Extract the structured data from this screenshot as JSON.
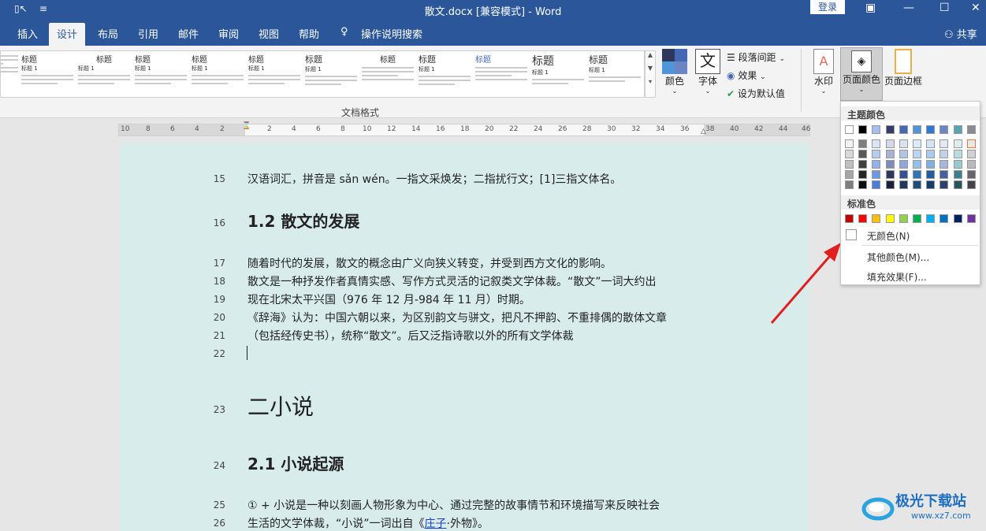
{
  "titlebar": {
    "title": "散文.docx [兼容模式]  -  Word",
    "login": "登录"
  },
  "tabs": [
    "插入",
    "设计",
    "布局",
    "引用",
    "邮件",
    "审阅",
    "视图",
    "帮助",
    "操作说明搜索"
  ],
  "share": "共享",
  "ribbon": {
    "gallery_title": "标题",
    "gallery_heading1": "标题 1",
    "group_label": "文档格式",
    "colors_label": "颜色",
    "fonts_label": "字体",
    "fonts_glyph": "文",
    "paragraph_spacing": "段落间距",
    "effects": "效果",
    "set_default": "设为默认值",
    "watermark": "水印",
    "page_color": "页面颜色",
    "page_borders": "页面边框"
  },
  "ruler": {
    "left_numbers": [
      "10",
      "8",
      "6",
      "4",
      "2"
    ],
    "right_numbers": [
      "2",
      "4",
      "6",
      "8",
      "10",
      "12",
      "14",
      "16",
      "18",
      "20",
      "22",
      "24",
      "26",
      "28",
      "30",
      "32",
      "34",
      "36",
      "38",
      "40",
      "42",
      "44",
      "46"
    ]
  },
  "document": {
    "lines": [
      {
        "no": "15",
        "text": "汉语词汇，拼音是 sǎn wén。一指文采焕发；二指扰行文；[1]三指文体名。",
        "style": "body"
      },
      {
        "no": "16",
        "text": "1.2 散文的发展",
        "style": "h2"
      },
      {
        "no": "17",
        "text": "随着时代的发展，散文的概念由广义向狭义转变，并受到西方文化的影响。",
        "style": "body"
      },
      {
        "no": "18",
        "text": "散文是一种抒发作者真情实感、写作方式灵活的记叙类文学体裁。“散文”一词大约出",
        "style": "body"
      },
      {
        "no": "19",
        "text": "现在北宋太平兴国（976 年 12 月-984 年 11 月）时期。",
        "style": "body"
      },
      {
        "no": "20",
        "text": "《辞海》认为：中国六朝以来，为区别韵文与骈文，把凡不押韵、不重排偶的散体文章",
        "style": "body"
      },
      {
        "no": "21",
        "text": "（包括经传史书），统称“散文”。后又泛指诗歌以外的所有文学体裁",
        "style": "body"
      },
      {
        "no": "22",
        "text": "",
        "style": "body"
      },
      {
        "no": "23",
        "text": "二小说",
        "style": "h1"
      },
      {
        "no": "24",
        "text": "2.1 小说起源",
        "style": "h2"
      },
      {
        "no": "25",
        "text": "① + 小说是一种以刻画人物形象为中心、通过完整的故事情节和环境描写来反映社会",
        "style": "body"
      },
      {
        "no": "26",
        "text_before": "生活的文学体裁，“小说”一词出自《",
        "link": "庄子",
        "text_after": "·外物》。",
        "style": "body"
      }
    ]
  },
  "dropdown": {
    "theme_colors_label": "主题颜色",
    "standard_colors_label": "标准色",
    "no_color": "无颜色(N)",
    "more_colors": "其他颜色(M)...",
    "fill_effects": "填充效果(F)...",
    "theme_top": [
      "#ffffff",
      "#000000",
      "#a5c0ef",
      "#333e66",
      "#4568b5",
      "#4f95d8",
      "#2e7ad2",
      "#6c86c5",
      "#58a5b0",
      "#8b8a93"
    ],
    "theme_shades": [
      [
        "#f2f2f2",
        "#d8d8d8",
        "#bfbfbf",
        "#a5a5a5",
        "#7f7f7f"
      ],
      [
        "#7f7f7f",
        "#595959",
        "#3f3f3f",
        "#262626",
        "#0c0c0c"
      ],
      [
        "#dbe5f8",
        "#b7cbf1",
        "#93b2ea",
        "#6e98e3",
        "#4c7ed9"
      ],
      [
        "#d4d8e8",
        "#a9b2d2",
        "#7e8bbb",
        "#2d375c",
        "#1c223a"
      ],
      [
        "#d9e1f2",
        "#b3c3e5",
        "#8ea6d8",
        "#345090",
        "#233660"
      ],
      [
        "#dcebf8",
        "#b9d5f1",
        "#95c0eb",
        "#2f74b5",
        "#1f4d79"
      ],
      [
        "#d5e4f6",
        "#abcaed",
        "#81afe3",
        "#225da0",
        "#163e6a"
      ],
      [
        "#e1e7f3",
        "#c4cfe8",
        "#a6b6dc",
        "#4460a2",
        "#2d406c"
      ],
      [
        "#dcedef",
        "#badbe0",
        "#97c9d0",
        "#3c808a",
        "#28555c"
      ],
      [
        "#e8e8ea",
        "#d1d0d4",
        "#b9b9be",
        "#67666e",
        "#454449"
      ]
    ],
    "standard": [
      "#c00000",
      "#ff0000",
      "#ffc000",
      "#ffff00",
      "#92d050",
      "#00b050",
      "#00b0f0",
      "#0070c0",
      "#002060",
      "#7030a0"
    ]
  },
  "brand": {
    "watermark_text": "极光下载站",
    "watermark_url": "www.xz7.com"
  }
}
